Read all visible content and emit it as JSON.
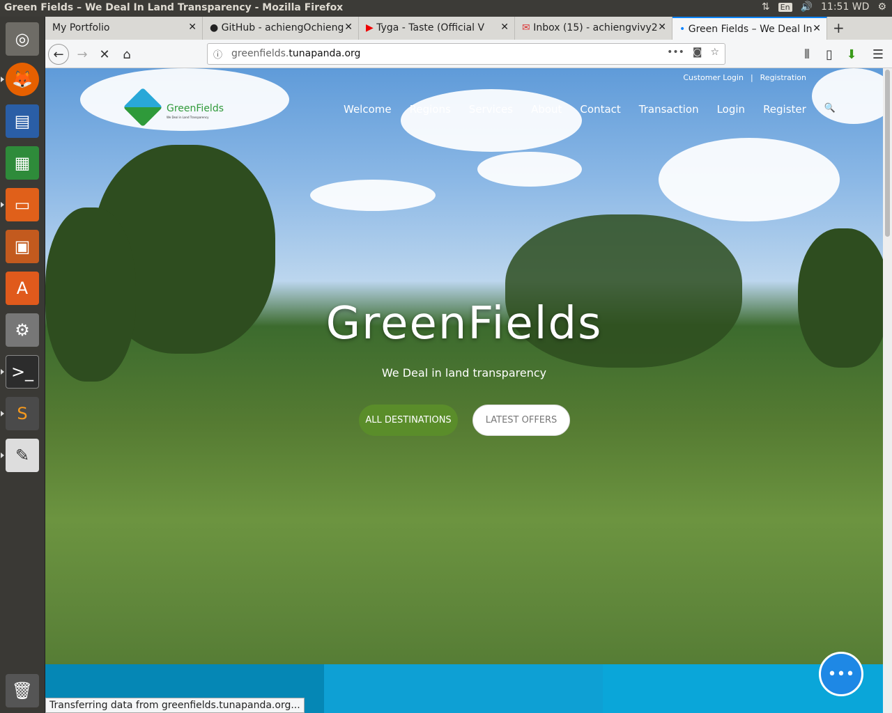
{
  "window": {
    "title": "Green Fields – We Deal In Land Transparency - Mozilla Firefox",
    "tray": {
      "lang": "En",
      "clock": "11:51 WD"
    }
  },
  "tabs": [
    {
      "label": "My Portfolio"
    },
    {
      "label": "GitHub - achiengOchieng"
    },
    {
      "label": "Tyga - Taste (Official V"
    },
    {
      "label": "Inbox (15) - achiengvivy2"
    },
    {
      "label": "Green Fields – We Deal In"
    }
  ],
  "url": {
    "prefix": "greenfields.",
    "domain": "tunapanda.org"
  },
  "site": {
    "logo_name": "GreenFields",
    "logo_tag": "We Deal in Land Transparency",
    "top_links": [
      "Customer Login",
      "Registration"
    ],
    "nav": [
      "Welcome",
      "Regions",
      "Services",
      "About",
      "Contact",
      "Transaction",
      "Login",
      "Register"
    ],
    "hero_title": "GreenFields",
    "hero_sub": "We Deal in land transparency",
    "btn_destinations": "ALL DESTINATIONS",
    "btn_offers": "LATEST OFFERS"
  },
  "status": "Transferring data from greenfields.tunapanda.org...",
  "colors": {
    "accent": "#5a8d2a",
    "band1": "#0587b5",
    "band2": "#0ea0d4",
    "band3": "#0aa6d9"
  }
}
